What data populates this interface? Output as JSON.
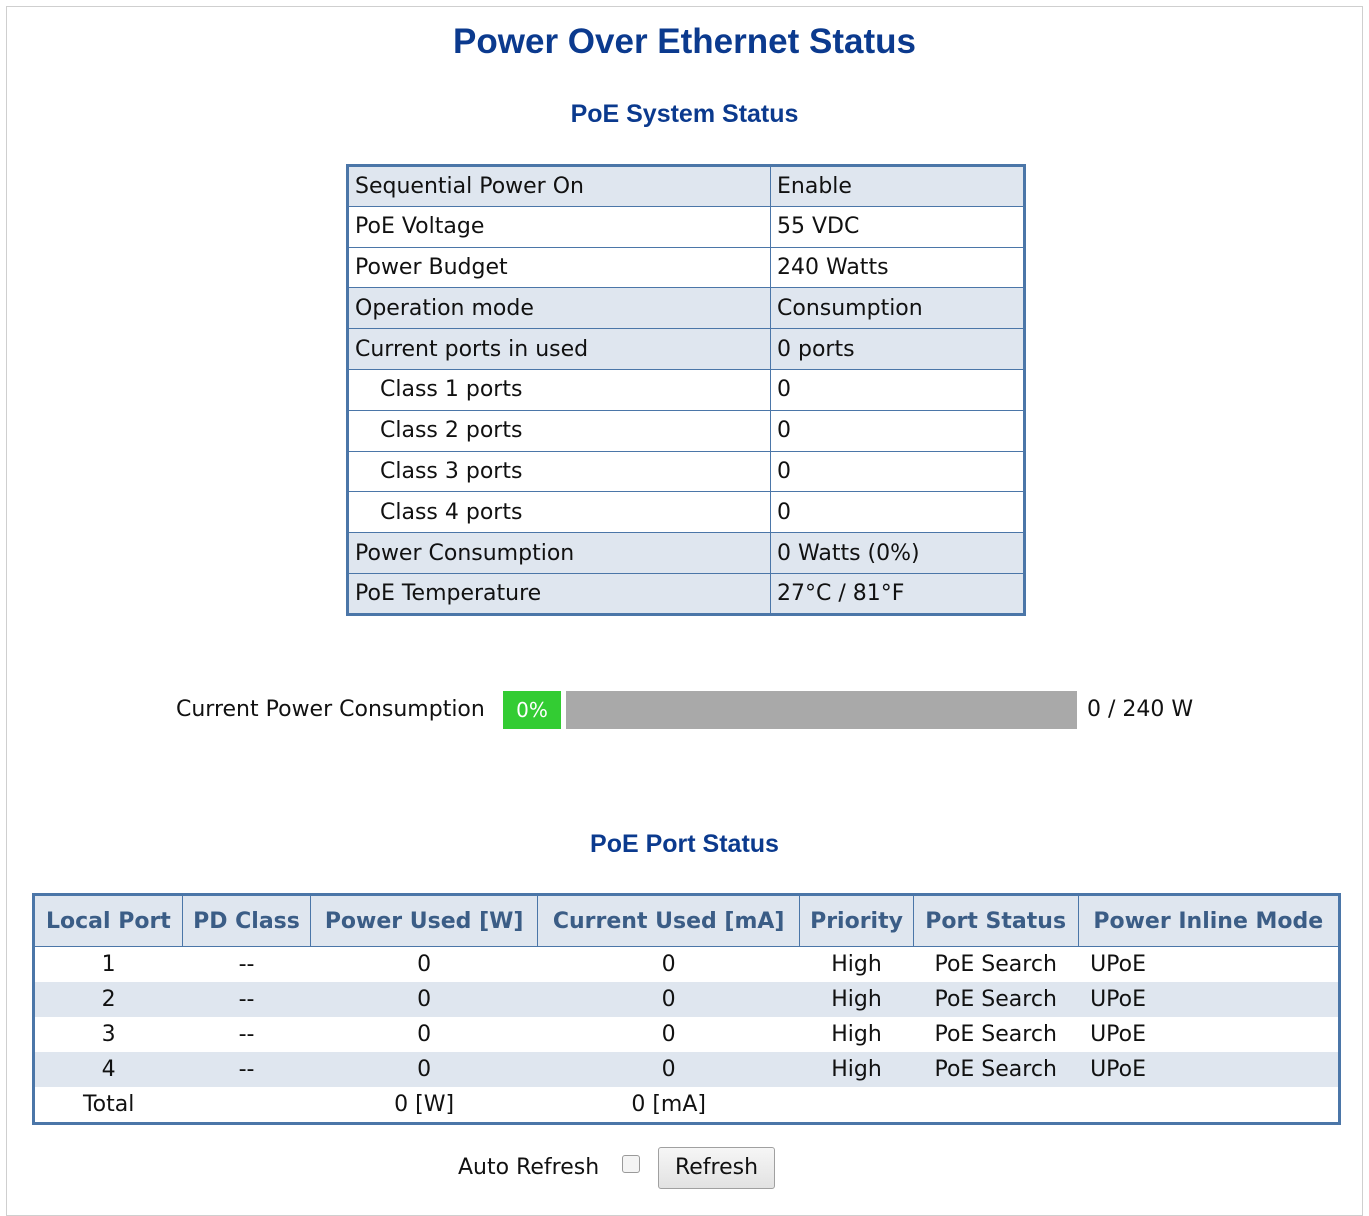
{
  "page_title": "Power Over Ethernet Status",
  "system": {
    "title": "PoE System Status",
    "rows": [
      {
        "label": "Sequential Power On",
        "value": "Enable"
      },
      {
        "label": "PoE Voltage",
        "value": "55 VDC"
      },
      {
        "label": "Power Budget",
        "value": "240 Watts"
      },
      {
        "label": "Operation mode",
        "value": "Consumption"
      },
      {
        "label": "Current ports in used",
        "value": "0 ports"
      },
      {
        "label": "Class 1 ports",
        "value": "0"
      },
      {
        "label": "Class 2 ports",
        "value": "0"
      },
      {
        "label": "Class 3 ports",
        "value": "0"
      },
      {
        "label": "Class 4 ports",
        "value": "0"
      },
      {
        "label": "Power Consumption",
        "value": "0 Watts (0%)"
      },
      {
        "label": "PoE Temperature",
        "value": "27°C / 81°F"
      }
    ]
  },
  "power_bar": {
    "label": "Current Power Consumption",
    "percent_text": "0%",
    "usage_fraction": 0,
    "total_text": "0 / 240 W",
    "fill_color": "#33cc33",
    "track_color": "#a9a9a9"
  },
  "ports": {
    "title": "PoE Port Status",
    "headers": [
      "Local Port",
      "PD Class",
      "Power Used [W]",
      "Current Used [mA]",
      "Priority",
      "Port Status",
      "Power Inline Mode"
    ],
    "rows": [
      {
        "port": "1",
        "pd_class": "--",
        "power": "0",
        "current": "0",
        "priority": "High",
        "status": "PoE Search",
        "mode": "UPoE"
      },
      {
        "port": "2",
        "pd_class": "--",
        "power": "0",
        "current": "0",
        "priority": "High",
        "status": "PoE Search",
        "mode": "UPoE"
      },
      {
        "port": "3",
        "pd_class": "--",
        "power": "0",
        "current": "0",
        "priority": "High",
        "status": "PoE Search",
        "mode": "UPoE"
      },
      {
        "port": "4",
        "pd_class": "--",
        "power": "0",
        "current": "0",
        "priority": "High",
        "status": "PoE Search",
        "mode": "UPoE"
      }
    ],
    "total": {
      "label": "Total",
      "power": "0 [W]",
      "current": "0 [mA]"
    }
  },
  "controls": {
    "auto_refresh_label": "Auto Refresh",
    "auto_refresh_checked": false,
    "refresh_label": "Refresh"
  },
  "colors": {
    "title": "#0b3a8e",
    "table_border": "#4b76a8",
    "alt_row": "#dfe6ef",
    "header_text": "#3b5d86"
  }
}
